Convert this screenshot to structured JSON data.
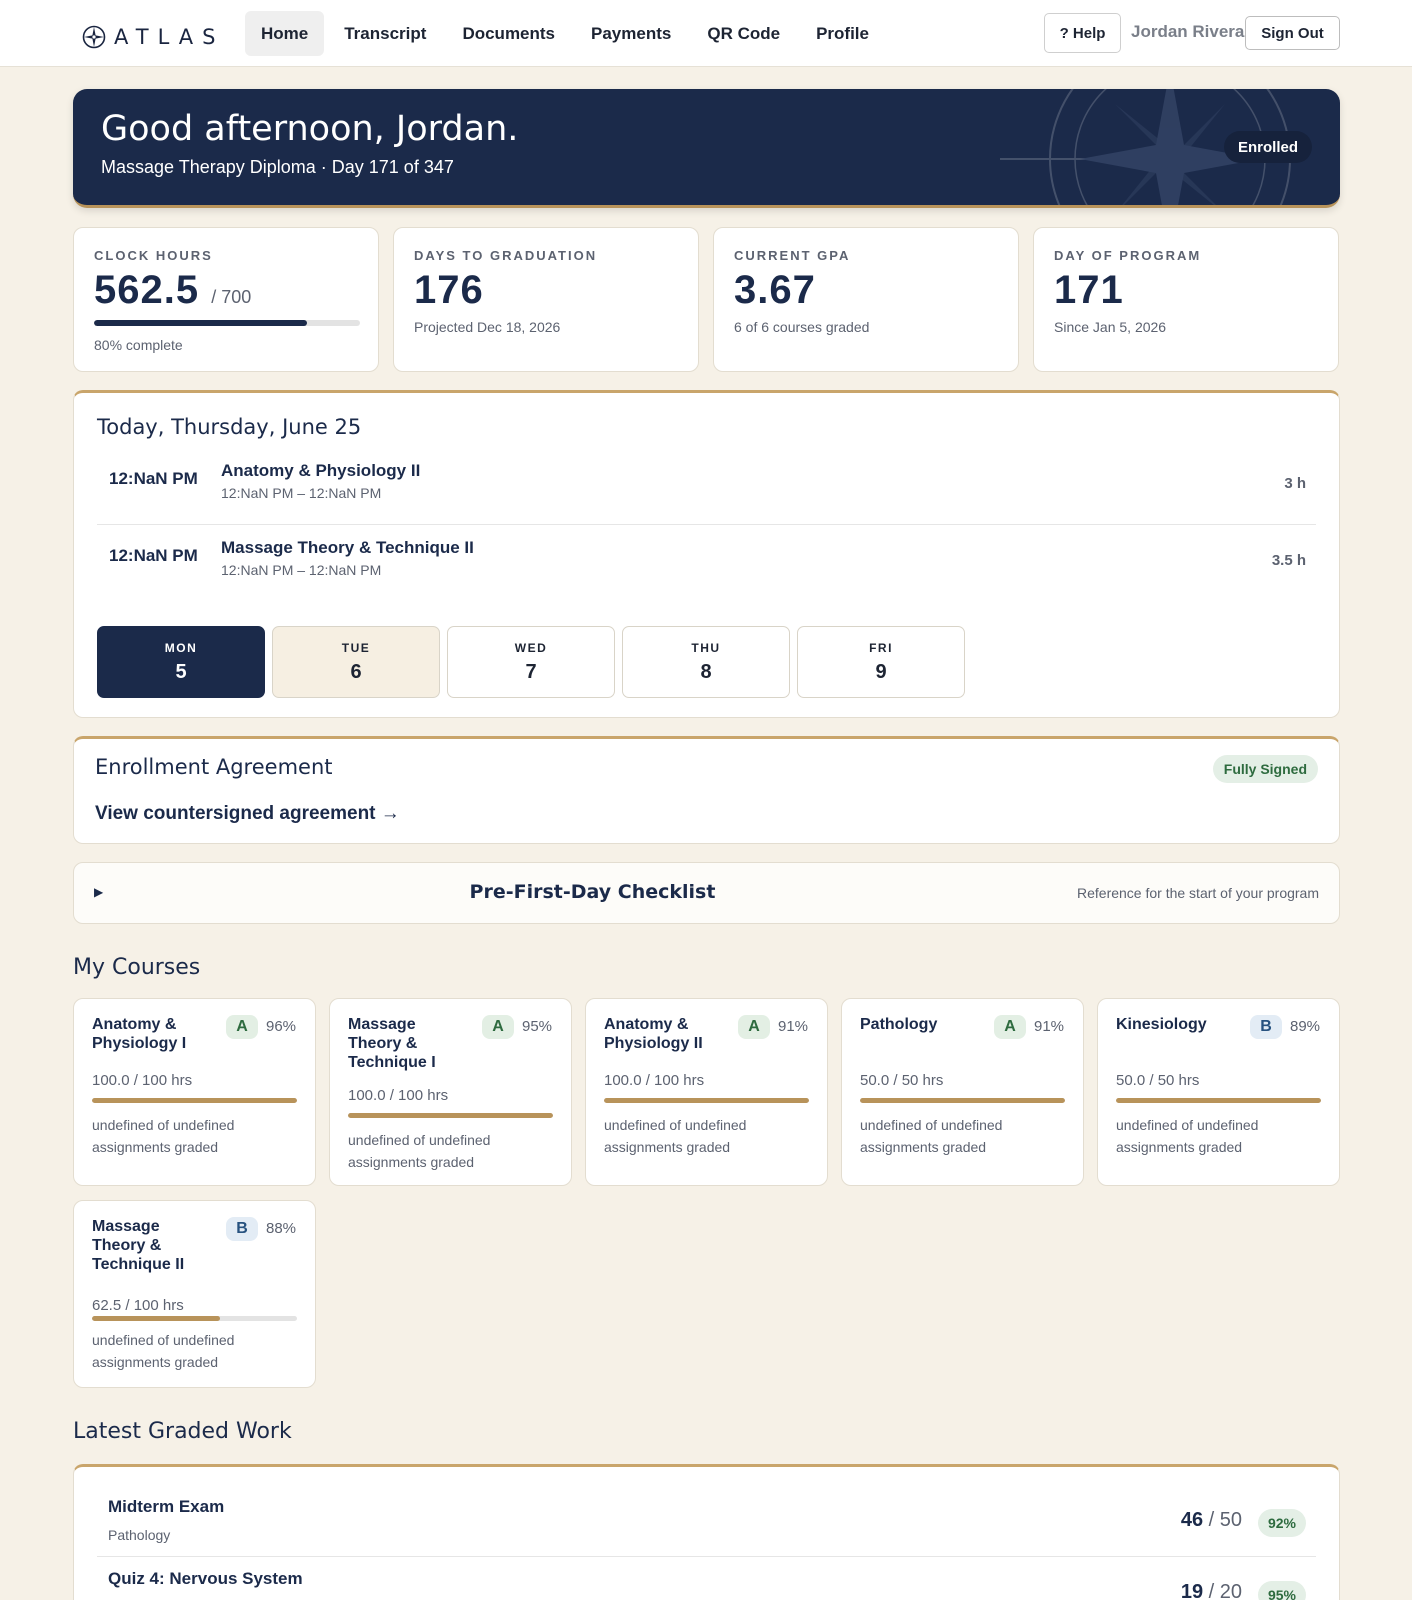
{
  "app": {
    "brand": "ATLAS"
  },
  "nav": {
    "items": [
      "Home",
      "Transcript",
      "Documents",
      "Payments",
      "QR Code",
      "Profile"
    ],
    "active": "Home",
    "help_label": "? Help",
    "user_name": "Jordan Rivera",
    "signout_label": "Sign Out"
  },
  "hero": {
    "greeting": "Good afternoon, Jordan.",
    "subtitle": "Massage Therapy Diploma · Day 171 of 347",
    "badge": "Enrolled"
  },
  "stats": [
    {
      "label": "CLOCK HOURS",
      "value": "562.5",
      "of": "/ 700",
      "progress": 0.8,
      "sub": "80% complete"
    },
    {
      "label": "DAYS TO GRADUATION",
      "value": "176",
      "sub": "Projected Dec 18, 2026"
    },
    {
      "label": "CURRENT GPA",
      "value": "3.67",
      "sub": "6 of 6 courses graded"
    },
    {
      "label": "DAY OF PROGRAM",
      "value": "171",
      "sub": "Since Jan 5, 2026"
    }
  ],
  "today": {
    "title": "Today, Thursday, June 25",
    "schedule": [
      {
        "time": "12:NaN PM",
        "name": "Anatomy & Physiology II",
        "range": "12:NaN PM – 12:NaN PM",
        "hours": "3 h"
      },
      {
        "time": "12:NaN PM",
        "name": "Massage Theory & Technique II",
        "range": "12:NaN PM – 12:NaN PM",
        "hours": "3.5 h"
      }
    ],
    "days": [
      {
        "name": "MON",
        "num": "5",
        "state": "active"
      },
      {
        "name": "TUE",
        "num": "6",
        "state": "soft"
      },
      {
        "name": "WED",
        "num": "7",
        "state": ""
      },
      {
        "name": "THU",
        "num": "8",
        "state": ""
      },
      {
        "name": "FRI",
        "num": "9",
        "state": ""
      }
    ]
  },
  "agreement": {
    "title": "Enrollment Agreement",
    "badge": "Fully Signed",
    "link": "View countersigned agreement →"
  },
  "checklist": {
    "arrow": "▶",
    "title": "Pre-First-Day Checklist",
    "note": "Reference for the start of your program"
  },
  "courses_title": "My Courses",
  "courses": [
    {
      "name": "Anatomy & Physiology I",
      "grade": "A",
      "pct": "96%",
      "hours": "100.0 / 100 hrs",
      "progress": 1.0,
      "assign": "undefined of undefined assignments graded"
    },
    {
      "name": "Massage Theory & Technique I",
      "grade": "A",
      "pct": "95%",
      "hours": "100.0 / 100 hrs",
      "progress": 1.0,
      "assign": "undefined of undefined assignments graded"
    },
    {
      "name": "Anatomy & Physiology II",
      "grade": "A",
      "pct": "91%",
      "hours": "100.0 / 100 hrs",
      "progress": 1.0,
      "assign": "undefined of undefined assignments graded"
    },
    {
      "name": "Pathology",
      "grade": "A",
      "pct": "91%",
      "hours": "50.0 / 50 hrs",
      "progress": 1.0,
      "assign": "undefined of undefined assignments graded"
    },
    {
      "name": "Kinesiology",
      "grade": "B",
      "pct": "89%",
      "hours": "50.0 / 50 hrs",
      "progress": 1.0,
      "assign": "undefined of undefined assignments graded"
    },
    {
      "name": "Massage Theory & Technique II",
      "grade": "B",
      "pct": "88%",
      "hours": "62.5 / 100 hrs",
      "progress": 0.625,
      "assign": "undefined of undefined assignments graded"
    }
  ],
  "graded_title": "Latest Graded Work",
  "graded": [
    {
      "name": "Midterm Exam",
      "course": "Pathology",
      "score": "46",
      "total": "/ 50",
      "pct": "92%"
    },
    {
      "name": "Quiz 4: Nervous System",
      "course": "",
      "score": "19",
      "total": "/ 20",
      "pct": "95%"
    }
  ],
  "colors": {
    "navy": "#1b2a4a",
    "gold": "#b8935a",
    "background": "#f6f1e7"
  }
}
